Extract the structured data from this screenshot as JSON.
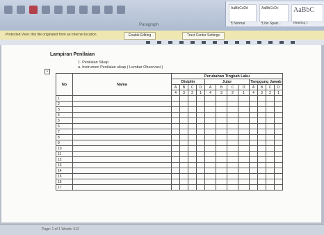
{
  "ribbon": {
    "group_label": "Paragraph",
    "styles": [
      {
        "sample": "AaBbCcDd",
        "name": "¶ Normal"
      },
      {
        "sample": "AaBbCcDc",
        "name": "¶ No Spaci..."
      },
      {
        "sample": "AaBbC",
        "name": "Heading 1"
      }
    ]
  },
  "message_bar": {
    "text": "Protected View: this file originated from an Internet location",
    "button_1": "Enable Editing",
    "button_2": "Trust Center Settings"
  },
  "document": {
    "title": "Lampiran Penilaian",
    "line1": "1.   Penilaian Sikap",
    "line2": "a.   Instrumen Penilaian sikap ( Lembar Observasi )",
    "table": {
      "col_no": "No",
      "col_nama": "Nama",
      "group_header": "Perubahan Tingkah Laku",
      "groups": [
        "Disiplin",
        "Jujur",
        "Tanggung Jawab"
      ],
      "sublabels": [
        "A",
        "B",
        "C",
        "D"
      ],
      "subnums": [
        "4",
        "3",
        "2",
        "1"
      ],
      "rows": [
        "1",
        "2",
        "3",
        "4",
        "5",
        "6",
        "7",
        "8",
        "9",
        "10",
        "11",
        "12",
        "13",
        "14",
        "15",
        "16",
        "17"
      ]
    }
  },
  "status": {
    "text": "Page: 1 of 1   Words: 512"
  }
}
